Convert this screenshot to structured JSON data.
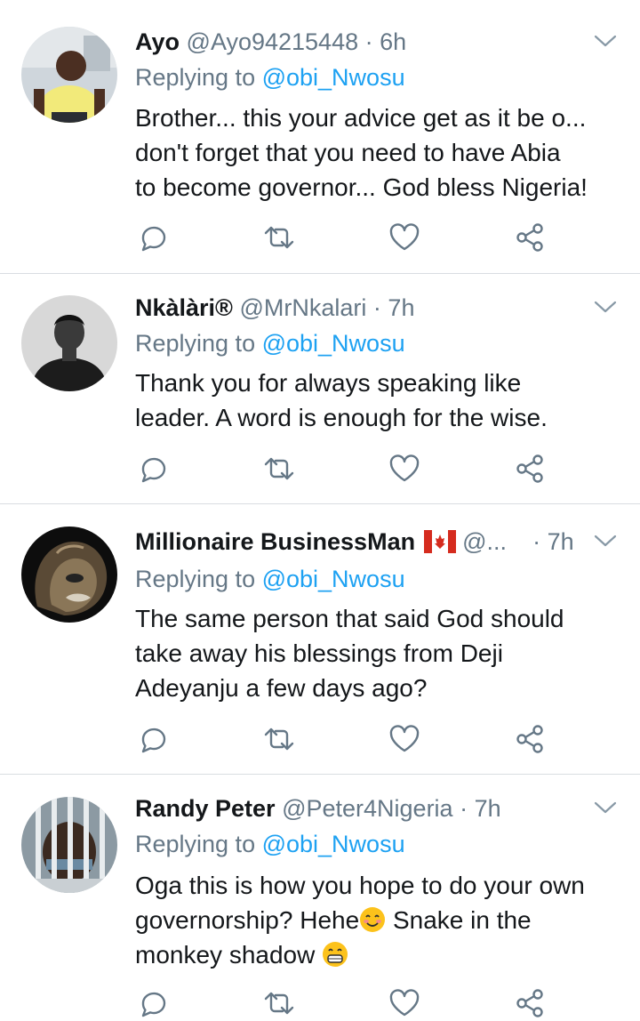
{
  "tweets": [
    {
      "name": "Ayo",
      "handle": "@Ayo94215448",
      "sep": "·",
      "time": "6h",
      "replying_label": "Replying to ",
      "replying_to": "@obi_Nwosu",
      "text_lines": [
        "Brother... this your advice get as it be o...",
        "don't forget that you need to have Abia",
        "to become governor... God bless Nigeria!"
      ],
      "avatar_icon": "user-avatar-yellow-shirt"
    },
    {
      "name": "Nkàlàri®",
      "handle": "@MrNkalari",
      "sep": "·",
      "time": "7h",
      "replying_label": "Replying to ",
      "replying_to": "@obi_Nwosu",
      "text_lines": [
        "Thank you for always speaking like",
        "leader. A word is enough for the wise."
      ],
      "avatar_icon": "user-avatar-grayscale"
    },
    {
      "name": "Millionaire BusinessMan",
      "handle": "@...",
      "sep": "·",
      "time": "7h",
      "replying_label": "Replying to ",
      "replying_to": "@obi_Nwosu",
      "text_lines": [
        "The same person that said God should",
        "take away his blessings from Deji",
        "Adeyanju a few days ago?"
      ],
      "avatar_icon": "lion-avatar",
      "flag_icon": "canada-flag-icon"
    },
    {
      "name": "Randy Peter",
      "handle": "@Peter4Nigeria",
      "sep": "·",
      "time": "7h",
      "replying_label": "Replying to ",
      "replying_to": "@obi_Nwosu",
      "text_lines": [
        "Oga this is how you hope to do your own",
        "governorship? Hehe",
        " Snake in the",
        "monkey shadow "
      ],
      "avatar_icon": "user-avatar-behind-bars"
    }
  ],
  "colors": {
    "name": "#14171a",
    "muted": "#657786",
    "mention": "#1da1f2",
    "divider": "#d9dde1"
  }
}
